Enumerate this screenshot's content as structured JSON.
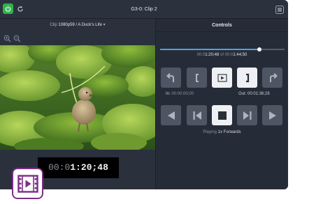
{
  "window": {
    "title": "G3-0: Clip 2"
  },
  "clip": {
    "prefix": "Clip",
    "name": "1080p59 / A Duck's Life"
  },
  "viewer": {
    "timecode_dim": "00:0",
    "timecode_bright": "1:20;48"
  },
  "controls": {
    "title": "Controls",
    "scrub_progress": 0.8,
    "position_dim": "00:0",
    "position_current": "1:20;48",
    "position_of": "of",
    "position_total_dim": "00:0",
    "position_total": "1:44;50",
    "in_label": "In:",
    "in_value": "00:00:00;00",
    "out_label": "Out:",
    "out_value": "00:01:36;28",
    "status_prefix": "Playing",
    "status_value": "1x Forwards"
  },
  "colors": {
    "accent": "#4da1e6",
    "power": "#2fb34b",
    "icon_border": "#7b2f86"
  },
  "icons": [
    "power-icon",
    "refresh-icon",
    "menu-icon",
    "zoom-in-icon",
    "zoom-out-icon",
    "undo-icon",
    "mark-in-icon",
    "clip-icon",
    "mark-out-icon",
    "redo-icon",
    "rewind-icon",
    "step-back-icon",
    "stop-icon",
    "step-forward-icon",
    "fast-forward-icon",
    "video-app-icon"
  ]
}
